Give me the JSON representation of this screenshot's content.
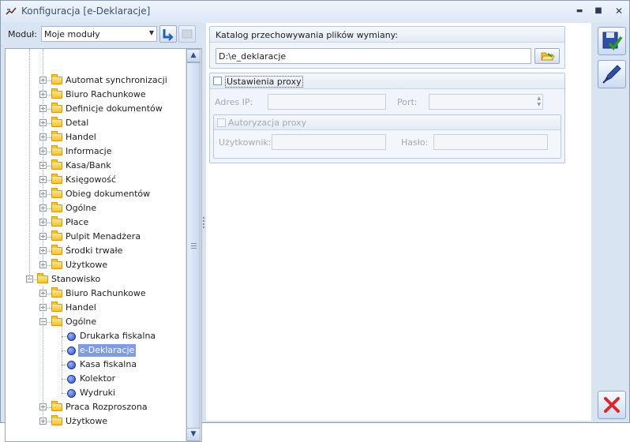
{
  "window": {
    "title": "Konfiguracja [e-Deklaracje]",
    "minimize_glyph": "▬",
    "maximize_glyph": "■",
    "close_glyph": "✕"
  },
  "module_selector": {
    "label": "Moduł:",
    "value": "Moje moduły"
  },
  "tree": {
    "items": [
      {
        "label": "Automat synchronizacji",
        "level": 2,
        "type": "folder"
      },
      {
        "label": "Biuro Rachunkowe",
        "level": 2,
        "type": "folder"
      },
      {
        "label": "Definicje dokumentów",
        "level": 2,
        "type": "folder"
      },
      {
        "label": "Detal",
        "level": 2,
        "type": "folder"
      },
      {
        "label": "Handel",
        "level": 2,
        "type": "folder"
      },
      {
        "label": "Informacje",
        "level": 2,
        "type": "folder"
      },
      {
        "label": "Kasa/Bank",
        "level": 2,
        "type": "folder"
      },
      {
        "label": "Księgowość",
        "level": 2,
        "type": "folder"
      },
      {
        "label": "Obieg dokumentów",
        "level": 2,
        "type": "folder"
      },
      {
        "label": "Ogólne",
        "level": 2,
        "type": "folder"
      },
      {
        "label": "Płace",
        "level": 2,
        "type": "folder"
      },
      {
        "label": "Pulpit Menadżera",
        "level": 2,
        "type": "folder"
      },
      {
        "label": "Środki trwałe",
        "level": 2,
        "type": "folder"
      },
      {
        "label": "Użytkowe",
        "level": 2,
        "type": "folder"
      },
      {
        "label": "Stanowisko",
        "level": 1,
        "type": "folder",
        "expanded": true
      },
      {
        "label": "Biuro Rachunkowe",
        "level": 2,
        "type": "folder"
      },
      {
        "label": "Handel",
        "level": 2,
        "type": "folder"
      },
      {
        "label": "Ogólne",
        "level": 2,
        "type": "folder",
        "expanded": true
      },
      {
        "label": "Drukarka fiskalna",
        "level": 3,
        "type": "leaf"
      },
      {
        "label": "e-Deklaracje",
        "level": 3,
        "type": "leaf",
        "selected": true
      },
      {
        "label": "Kasa fiskalna",
        "level": 3,
        "type": "leaf"
      },
      {
        "label": "Kolektor",
        "level": 3,
        "type": "leaf"
      },
      {
        "label": "Wydruki",
        "level": 3,
        "type": "leaf"
      },
      {
        "label": "Praca Rozproszona",
        "level": 2,
        "type": "folder"
      },
      {
        "label": "Użytkowe",
        "level": 2,
        "type": "folder"
      }
    ]
  },
  "exchange_dir": {
    "header": "Katalog przechowywania plików wymiany:",
    "value": "D:\\e_deklaracje"
  },
  "proxy": {
    "checkbox_label": "Ustawienia proxy",
    "checked": false,
    "address_label": "Adres IP:",
    "address_value": "",
    "port_label": "Port:",
    "port_value": "",
    "auth_checkbox_label": "Autoryzacja proxy",
    "auth_checked": false,
    "user_label": "Użytkownik:",
    "user_value": "",
    "password_label": "Hasło:",
    "password_value": ""
  },
  "icons": {
    "save": "save-icon",
    "edit": "edit-icon",
    "cancel": "cancel-icon"
  }
}
